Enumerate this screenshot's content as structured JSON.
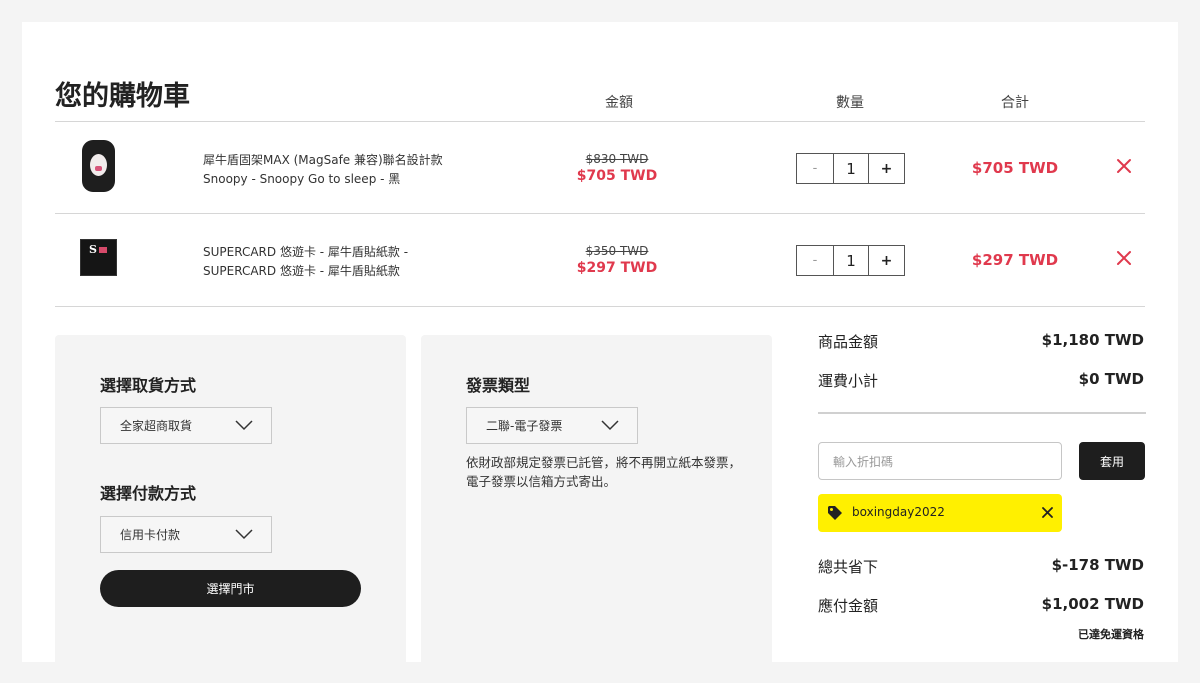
{
  "cart": {
    "title": "您的購物車",
    "columns": {
      "price": "金額",
      "quantity": "數量",
      "subtotal": "合計"
    },
    "items": [
      {
        "name_line1": "犀牛盾固架MAX (MagSafe 兼容)聯名設計款",
        "name_line2": "Snoopy - Snoopy Go to sleep - 黑",
        "original_price": "$830 TWD",
        "sale_price": "$705 TWD",
        "quantity": "1",
        "minus": "-",
        "plus": "+",
        "subtotal": "$705 TWD",
        "thumbnail_icon": "snoopy-phone-case"
      },
      {
        "name_line1": "SUPERCARD 悠遊卡 - 犀牛盾貼紙款 -",
        "name_line2": "SUPERCARD 悠遊卡 - 犀牛盾貼紙款",
        "original_price": "$350 TWD",
        "sale_price": "$297 TWD",
        "quantity": "1",
        "minus": "-",
        "plus": "+",
        "subtotal": "$297 TWD",
        "thumbnail_icon": "supercard",
        "thumbnail_text": "S"
      }
    ]
  },
  "shipping": {
    "title": "選擇取貨方式",
    "selected": "全家超商取貨",
    "payment_title": "選擇付款方式",
    "payment_selected": "信用卡付款",
    "store_button": "選擇門市"
  },
  "invoice": {
    "title": "發票類型",
    "selected": "二聯-電子發票",
    "note": "依財政部規定發票已託管，將不再開立紙本發票，電子發票以信箱方式寄出。"
  },
  "summary": {
    "items_label": "商品金額",
    "items_value": "$1,180 TWD",
    "shipping_label": "運費小計",
    "shipping_value": "$0 TWD",
    "coupon_placeholder": "輸入折扣碼",
    "apply_button": "套用",
    "applied_coupon": "boxingday2022",
    "savings_label": "總共省下",
    "savings_value": "$-178 TWD",
    "total_label": "應付金額",
    "total_value": "$1,002 TWD",
    "free_shipping_note": "已達免運資格"
  },
  "colors": {
    "accent": "#e0394d",
    "coupon": "#fff000",
    "dark": "#1e1e1e"
  }
}
